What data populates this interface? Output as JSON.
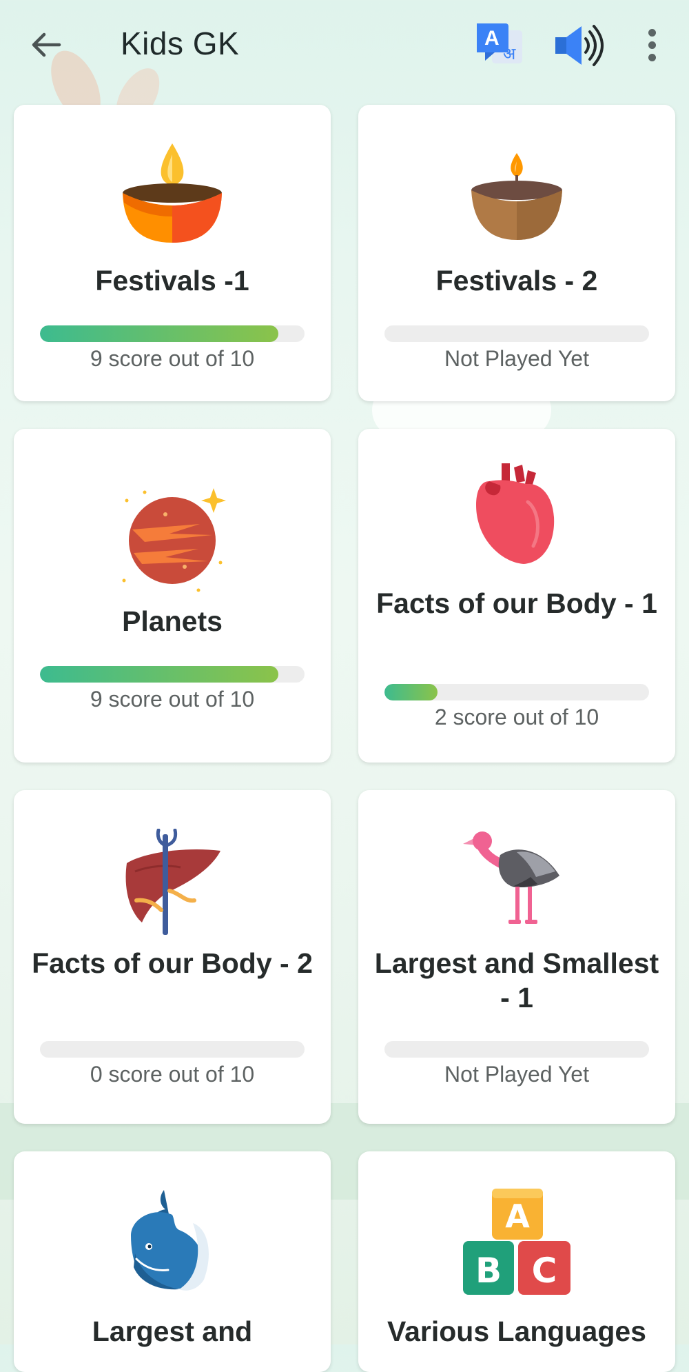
{
  "app": {
    "title": "Kids GK",
    "translate_badge": {
      "latin": "A",
      "devanagari": "अ"
    }
  },
  "colors": {
    "progress_start": "#3dbb8f",
    "progress_end": "#8bc34a",
    "track": "#ededed",
    "translate_blue": "#3b82f6"
  },
  "icons": {
    "back": "arrow-left-icon",
    "translate": "translate-icon",
    "sound": "speaker-icon",
    "more": "more-vert-icon"
  },
  "cards": [
    {
      "title": "Festivals -1",
      "status": "9 score out of 10",
      "progress": 0.9,
      "icon": "diya-lamp-icon"
    },
    {
      "title": "Festivals - 2",
      "status": "Not Played Yet",
      "progress": 0,
      "icon": "clay-lamp-icon"
    },
    {
      "title": "Planets",
      "status": "9 score out of 10",
      "progress": 0.9,
      "icon": "planet-icon"
    },
    {
      "title": "Facts of our Body - 1",
      "status": "2 score out of 10",
      "progress": 0.2,
      "icon": "heart-icon"
    },
    {
      "title": "Facts of our Body - 2",
      "status": "0 score out of 10",
      "progress": 0,
      "icon": "liver-icon"
    },
    {
      "title": "Largest and Smallest - 1",
      "status": "Not Played Yet",
      "progress": 0,
      "icon": "ostrich-icon"
    },
    {
      "title": "Largest and",
      "status": "",
      "progress": 0,
      "icon": "whale-icon"
    },
    {
      "title": "Various Languages",
      "status": "",
      "progress": 0,
      "icon": "abc-blocks-icon"
    }
  ]
}
